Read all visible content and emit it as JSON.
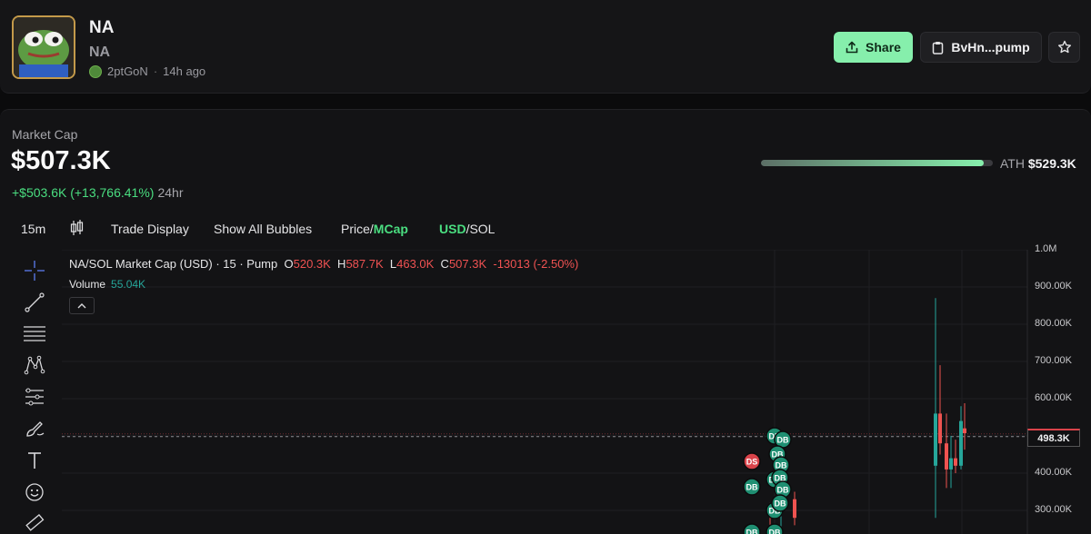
{
  "header": {
    "token_name": "NA",
    "token_symbol": "NA",
    "creator": "2ptGoN",
    "age": "14h ago",
    "share_label": "Share",
    "address_label": "BvHn...pump"
  },
  "market": {
    "label": "Market Cap",
    "value": "$507.3K",
    "change": "+$503.6K (+13,766.41%)",
    "period": "24hr",
    "ath_label": "ATH",
    "ath_value": "$529.3K",
    "ath_progress": 0.96
  },
  "toolbar": {
    "interval": "15m",
    "trade_display": "Trade Display",
    "show_bubbles": "Show All Bubbles",
    "price_label": "Price",
    "mcap_label": "MCap",
    "usd_label": "USD",
    "sol_label": "SOL"
  },
  "chart": {
    "title": "NA/SOL Market Cap (USD) · 15 · Pump",
    "o_label": "O",
    "o_value": "520.3K",
    "h_label": "H",
    "h_value": "587.7K",
    "l_label": "L",
    "l_value": "463.0K",
    "c_label": "C",
    "c_value": "507.3K",
    "change_value": "-13013 (-2.50%)",
    "volume_label": "Volume",
    "volume_value": "55.04K",
    "y_ticks": [
      "1.0M",
      "900.00K",
      "800.00K",
      "700.00K",
      "600.00K",
      "400.00K",
      "300.00K"
    ],
    "current_price": "498.3K",
    "bubble_ds": "DS",
    "bubble_db": "DB"
  },
  "colors": {
    "accent_green": "#86efac",
    "up": "#26a69a",
    "down": "#ef5350",
    "avatar_border": "#c49a4a"
  },
  "chart_data": {
    "type": "candlestick",
    "ylim": [
      250000,
      1000000
    ],
    "y_ticks": [
      300000,
      400000,
      600000,
      700000,
      800000,
      900000,
      1000000
    ],
    "current_price": 498300,
    "candles": [
      {
        "o": 300000,
        "h": 320000,
        "l": 250000,
        "c": 290000
      },
      {
        "o": 290000,
        "h": 310000,
        "l": 250000,
        "c": 305000
      },
      {
        "o": 330000,
        "h": 350000,
        "l": 260000,
        "c": 280000
      },
      {
        "o": 420000,
        "h": 870000,
        "l": 280000,
        "c": 560000
      },
      {
        "o": 560000,
        "h": 690000,
        "l": 450000,
        "c": 480000
      },
      {
        "o": 480000,
        "h": 560000,
        "l": 360000,
        "c": 410000
      },
      {
        "o": 410000,
        "h": 500000,
        "l": 360000,
        "c": 440000
      },
      {
        "o": 440000,
        "h": 490000,
        "l": 400000,
        "c": 420000
      },
      {
        "o": 420000,
        "h": 580000,
        "l": 410000,
        "c": 540000
      },
      {
        "o": 520300,
        "h": 587700,
        "l": 463000,
        "c": 507300
      }
    ]
  }
}
